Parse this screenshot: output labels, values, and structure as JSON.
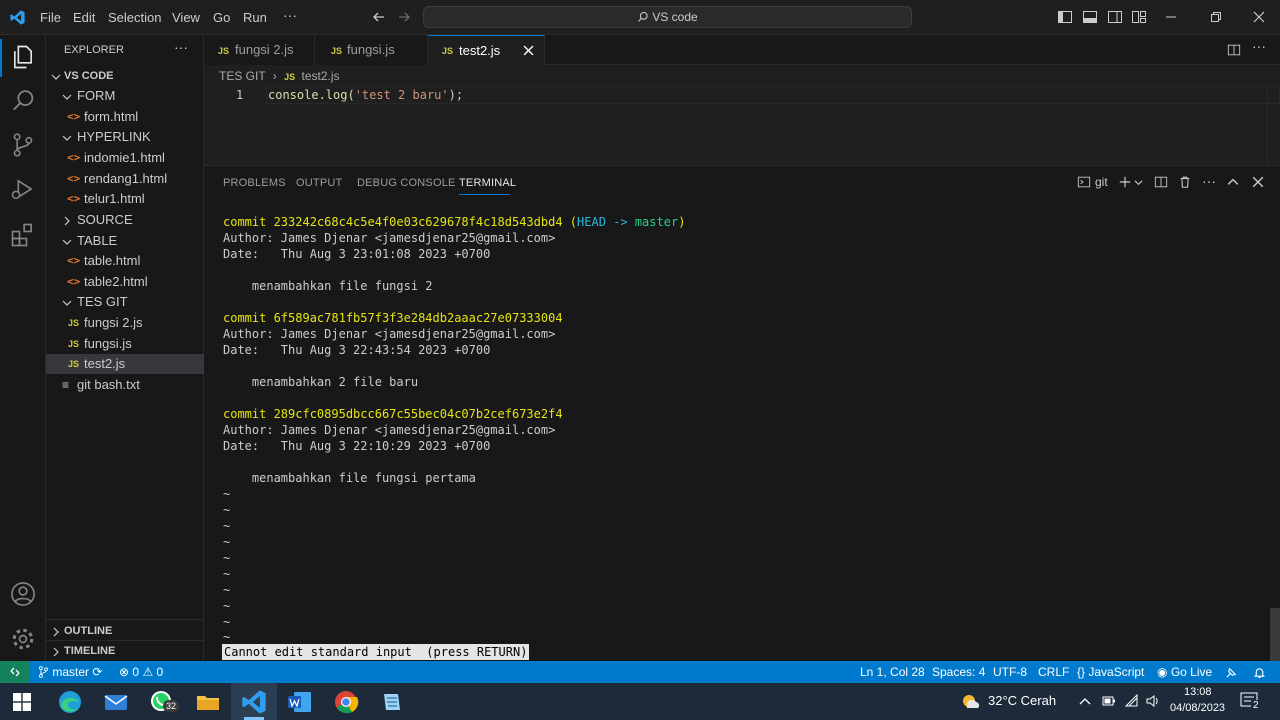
{
  "menu": [
    "File",
    "Edit",
    "Selection",
    "View",
    "Go",
    "Run",
    "···"
  ],
  "command_center": "VS code",
  "sidebar": {
    "title": "EXPLORER",
    "root": "VS CODE",
    "items": [
      {
        "label": "FORM",
        "kind": "folder"
      },
      {
        "label": "form.html",
        "kind": "html"
      },
      {
        "label": "HYPERLINK",
        "kind": "folder"
      },
      {
        "label": "indomie1.html",
        "kind": "html"
      },
      {
        "label": "rendang1.html",
        "kind": "html"
      },
      {
        "label": "telur1.html",
        "kind": "html"
      },
      {
        "label": "SOURCE",
        "kind": "folder-closed"
      },
      {
        "label": "TABLE",
        "kind": "folder"
      },
      {
        "label": "table.html",
        "kind": "html"
      },
      {
        "label": "table2.html",
        "kind": "html"
      },
      {
        "label": "TES GIT",
        "kind": "folder"
      },
      {
        "label": "fungsi 2.js",
        "kind": "js"
      },
      {
        "label": "fungsi.js",
        "kind": "js"
      },
      {
        "label": "test2.js",
        "kind": "js"
      },
      {
        "label": "git bash.txt",
        "kind": "txt"
      }
    ],
    "outline": "OUTLINE",
    "timeline": "TIMELINE"
  },
  "tabs": [
    {
      "label": "fungsi 2.js"
    },
    {
      "label": "fungsi.js"
    },
    {
      "label": "test2.js"
    }
  ],
  "breadcrumb": {
    "folder": "TES GIT",
    "file": "test2.js"
  },
  "editor": {
    "line_number": "1",
    "code_fn": "console.log(",
    "code_str": "'test 2 baru'",
    "code_end": ");"
  },
  "panel": {
    "tabs": [
      "PROBLEMS",
      "OUTPUT",
      "DEBUG CONSOLE",
      "TERMINAL"
    ],
    "terminal_name": "git",
    "lines": {
      "c1": "commit 233242c68c4c5e4f0e03c629678f4c18d543dbd4",
      "c1_head": "HEAD -> ",
      "c1_master": "master",
      "a1": "Author: James Djenar <jamesdjenar25@gmail.com>",
      "d1": "Date:   Thu Aug 3 23:01:08 2023 +0700",
      "m1": "    menambahkan file fungsi 2",
      "c2": "commit 6f589ac781fb57f3f3e284db2aaac27e07333004",
      "a2": "Author: James Djenar <jamesdjenar25@gmail.com>",
      "d2": "Date:   Thu Aug 3 22:43:54 2023 +0700",
      "m2": "    menambahkan 2 file baru",
      "c3": "commit 289cfc0895dbcc667c55bec04c07b2cef673e2f4",
      "a3": "Author: James Djenar <jamesdjenar25@gmail.com>",
      "d3": "Date:   Thu Aug 3 22:10:29 2023 +0700",
      "m3": "    menambahkan file fungsi pertama",
      "tilde": "~",
      "prompt": "Cannot edit standard input  (press RETURN)"
    }
  },
  "status": {
    "branch": "master",
    "errors": "0",
    "warnings": "0",
    "position": "Ln 1, Col 28",
    "spaces": "Spaces: 4",
    "encoding": "UTF-8",
    "eol": "CRLF",
    "language": "JavaScript",
    "golive": "Go Live"
  },
  "taskbar": {
    "whatsapp_badge": "32",
    "weather": "32°C  Cerah",
    "time": "13:08",
    "date": "04/08/2023",
    "notifications": "2"
  },
  "colors": {
    "accent": "#007acc",
    "commit": "#e5e510",
    "head": "#29b8db",
    "branch": "#23d18b"
  }
}
